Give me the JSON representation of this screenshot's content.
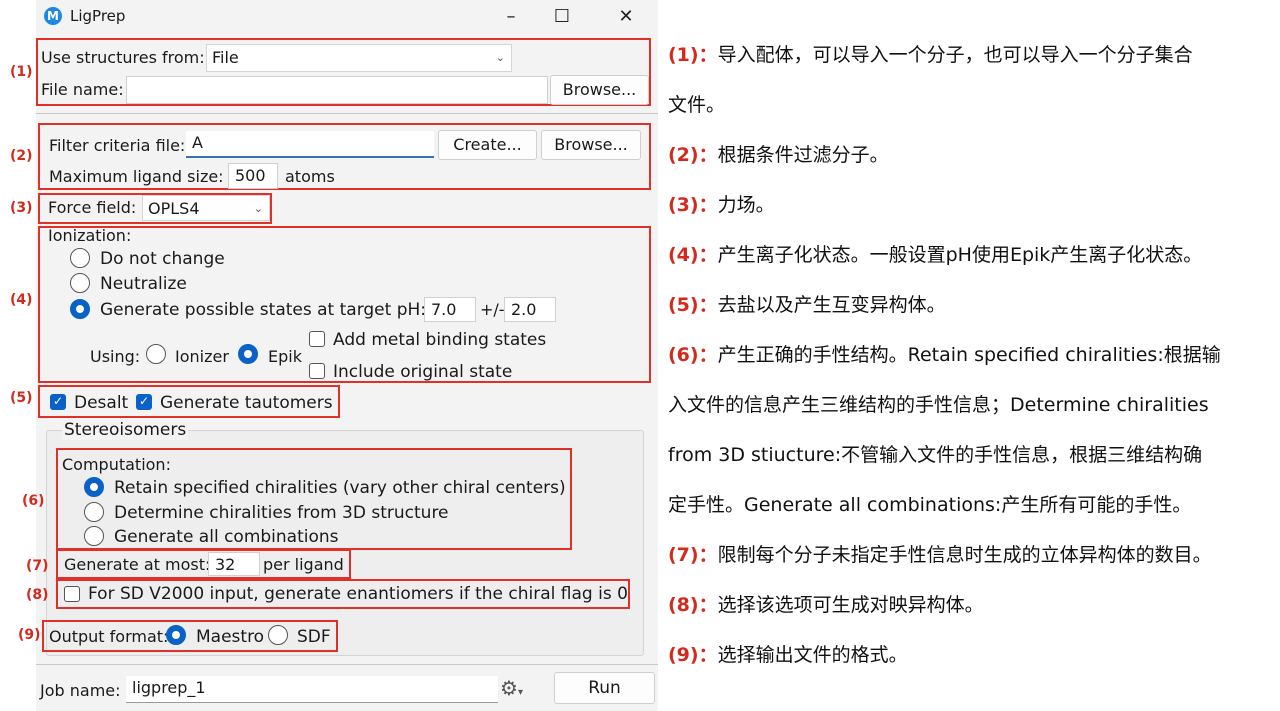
{
  "window": {
    "title": "LigPrep",
    "icon_letter": "M",
    "controls": [
      "–",
      "☐",
      "✕"
    ]
  },
  "colors": {
    "accent": "#0a62c9",
    "annotation_red": "#e0302a"
  },
  "source": {
    "label": "Use structures from:",
    "value": "File",
    "file_label": "File name:",
    "file_value": "",
    "browse": "Browse..."
  },
  "filter": {
    "label": "Filter criteria file:",
    "value": "A",
    "create": "Create...",
    "browse": "Browse...",
    "max_label": "Maximum ligand size:",
    "max_value": "500",
    "max_unit": "atoms"
  },
  "forcefield": {
    "label": "Force field:",
    "value": "OPLS4"
  },
  "ionization": {
    "title": "Ionization:",
    "opt_none": "Do not change",
    "opt_neutral": "Neutralize",
    "opt_generate": "Generate possible states at target pH:",
    "ph": "7.0",
    "pm": "+/-",
    "pm_value": "2.0",
    "using": "Using:",
    "ionizer": "Ionizer",
    "epik": "Epik",
    "metal": "Add metal binding states",
    "original": "Include original state"
  },
  "desalt": {
    "desalt": "Desalt",
    "tautomers": "Generate tautomers"
  },
  "stereo": {
    "title": "Stereoisomers",
    "computation": "Computation:",
    "opt_retain": "Retain specified chiralities (vary other chiral centers)",
    "opt_determine": "Determine chiralities from 3D structure",
    "opt_all": "Generate all combinations",
    "atmost_label": "Generate at most:",
    "atmost_value": "32",
    "atmost_unit": "per ligand",
    "sd_option": "For SD V2000 input, generate enantiomers if the chiral flag is 0"
  },
  "output": {
    "label": "Output format:",
    "maestro": "Maestro",
    "sdf": "SDF"
  },
  "job": {
    "label": "Job name:",
    "value": "ligprep_1",
    "run": "Run"
  },
  "markers": [
    "(1)",
    "(2)",
    "(3)",
    "(4)",
    "(5)",
    "(6)",
    "(7)",
    "(8)",
    "(9)"
  ],
  "notes": [
    {
      "num": "(1)：",
      "text": "导入配体，可以导入一个分子，也可以导入一个分子集合"
    },
    {
      "num": "",
      "text": "文件。"
    },
    {
      "num": "(2)：",
      "text": "根据条件过滤分子。"
    },
    {
      "num": "(3)：",
      "text": "力场。"
    },
    {
      "num": "(4)：",
      "text": "产生离子化状态。一般设置pH使用Epik产生离子化状态。"
    },
    {
      "num": "(5)：",
      "text": "去盐以及产生互变异构体。"
    },
    {
      "num": "(6)：",
      "text": "产生正确的手性结构。Retain specified chiralities:根据输"
    },
    {
      "num": "",
      "text": "入文件的信息产生三维结构的手性信息；Determine chiralities"
    },
    {
      "num": "",
      "text": "from 3D stiucture:不管输入文件的手性信息，根据三维结构确"
    },
    {
      "num": "",
      "text": "定手性。Generate all combinations:产生所有可能的手性。"
    },
    {
      "num": "(7)：",
      "text": "限制每个分子未指定手性信息时生成的立体异构体的数目。"
    },
    {
      "num": "(8)：",
      "text": "选择该选项可生成对映异构体。"
    },
    {
      "num": "(9)：",
      "text": "选择输出文件的格式。"
    }
  ]
}
